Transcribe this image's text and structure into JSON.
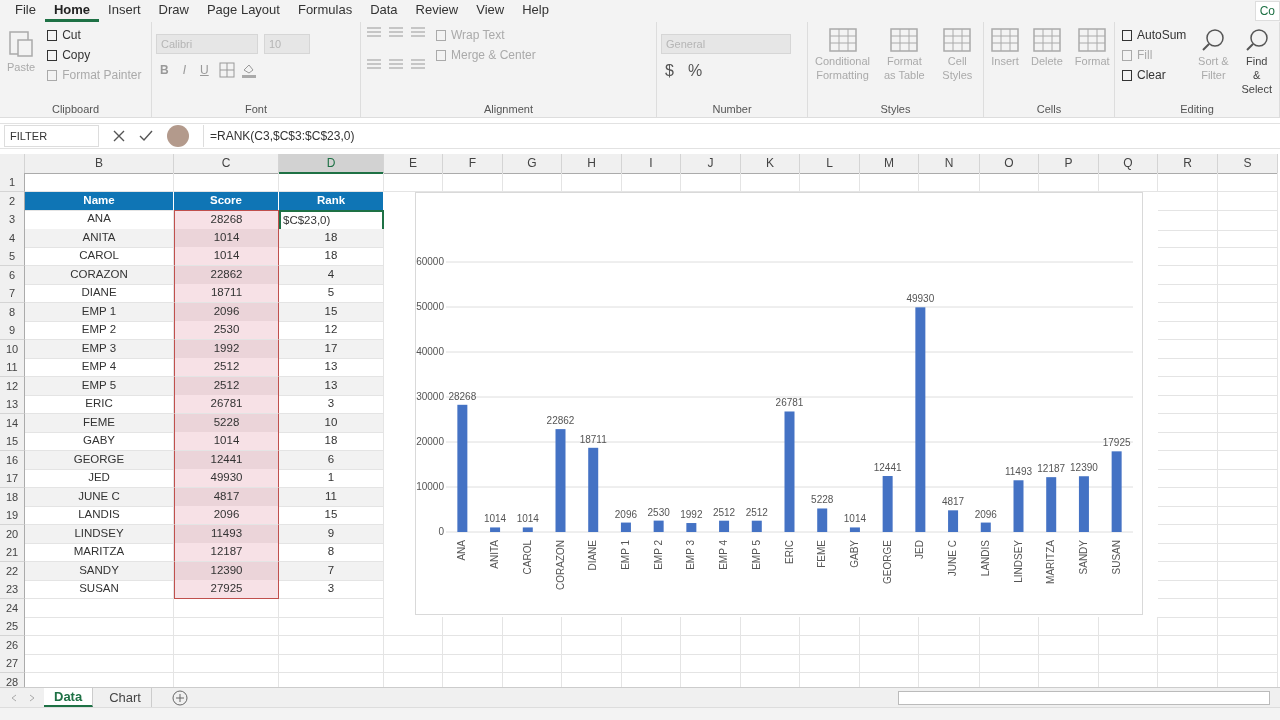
{
  "ribbon_tabs": [
    {
      "label": "File",
      "selected": false
    },
    {
      "label": "Home",
      "selected": true
    },
    {
      "label": "Insert",
      "selected": false
    },
    {
      "label": "Draw",
      "selected": false
    },
    {
      "label": "Page Layout",
      "selected": false
    },
    {
      "label": "Formulas",
      "selected": false
    },
    {
      "label": "Data",
      "selected": false
    },
    {
      "label": "Review",
      "selected": false
    },
    {
      "label": "View",
      "selected": false
    },
    {
      "label": "Help",
      "selected": false
    }
  ],
  "comments_button": "Co",
  "ribbon_groups": [
    {
      "label": "Clipboard",
      "kind": "clipboard",
      "buttons": [
        {
          "label": "Paste",
          "disabled": true
        },
        {
          "label": "Cut",
          "disabled": false
        },
        {
          "label": "Copy",
          "disabled": false
        },
        {
          "label": "Format Painter",
          "disabled": true
        }
      ]
    },
    {
      "label": "Font",
      "kind": "font",
      "font_name": "Calibri",
      "font_size": "10",
      "format_buttons": [
        "B",
        "I",
        "U"
      ]
    },
    {
      "label": "Alignment",
      "kind": "alignment",
      "buttons": [
        {
          "label": "Wrap Text",
          "disabled": true
        },
        {
          "label": "Merge & Center",
          "disabled": true
        }
      ]
    },
    {
      "label": "Number",
      "kind": "number",
      "format": "General",
      "format_buttons": [
        "$",
        "%"
      ]
    },
    {
      "label": "Styles",
      "kind": "large",
      "buttons": [
        {
          "label": "Conditional Formatting",
          "disabled": true
        },
        {
          "label": "Format as Table",
          "disabled": true
        },
        {
          "label": "Cell Styles",
          "disabled": true
        }
      ]
    },
    {
      "label": "Cells",
      "kind": "large",
      "buttons": [
        {
          "label": "Insert",
          "disabled": true
        },
        {
          "label": "Delete",
          "disabled": true
        },
        {
          "label": "Format",
          "disabled": true
        }
      ]
    },
    {
      "label": "Editing",
      "kind": "editing",
      "buttons": [
        {
          "label": "AutoSum",
          "disabled": false
        },
        {
          "label": "Fill",
          "disabled": true
        },
        {
          "label": "Clear",
          "disabled": false
        }
      ],
      "large_buttons": [
        {
          "label": "Sort & Filter",
          "disabled": true
        },
        {
          "label": "Find &",
          "label2": "Select",
          "disabled": false
        }
      ]
    }
  ],
  "formula_bar": {
    "name_box": "FILTER",
    "formula": "=RANK(C3,$C$3:$C$23,0)"
  },
  "sheet": {
    "columns": [
      {
        "label": "B",
        "selected": false
      },
      {
        "label": "C",
        "selected": false
      },
      {
        "label": "D",
        "selected": true
      },
      {
        "label": "E",
        "selected": false
      },
      {
        "label": "F",
        "selected": false
      },
      {
        "label": "G",
        "selected": false
      },
      {
        "label": "H",
        "selected": false
      },
      {
        "label": "I",
        "selected": false
      },
      {
        "label": "J",
        "selected": false
      },
      {
        "label": "K",
        "selected": false
      },
      {
        "label": "L",
        "selected": false
      },
      {
        "label": "M",
        "selected": false
      },
      {
        "label": "N",
        "selected": false
      },
      {
        "label": "O",
        "selected": false
      },
      {
        "label": "P",
        "selected": false
      },
      {
        "label": "Q",
        "selected": false
      },
      {
        "label": "R",
        "selected": false
      },
      {
        "label": "S",
        "selected": false
      }
    ],
    "row_numbers": [
      "1",
      "2",
      "3",
      "4",
      "5",
      "6",
      "7",
      "8",
      "9",
      "10",
      "11",
      "12",
      "13",
      "14",
      "15",
      "16",
      "17",
      "18",
      "19",
      "20",
      "21",
      "22",
      "23",
      "24",
      "25",
      "26",
      "27",
      "28"
    ]
  },
  "table": {
    "headers": [
      "Name",
      "Score",
      "Rank"
    ],
    "score_selected": true,
    "rows": [
      {
        "name": "ANA",
        "score": "28268",
        "rank": "$C$23,0)",
        "editing": true
      },
      {
        "name": "ANITA",
        "score": "1014",
        "rank": "18",
        "editing": false
      },
      {
        "name": "CAROL",
        "score": "1014",
        "rank": "18",
        "editing": false
      },
      {
        "name": "CORAZON",
        "score": "22862",
        "rank": "4",
        "editing": false
      },
      {
        "name": "DIANE",
        "score": "18711",
        "rank": "5",
        "editing": false
      },
      {
        "name": "EMP 1",
        "score": "2096",
        "rank": "15",
        "editing": false
      },
      {
        "name": "EMP 2",
        "score": "2530",
        "rank": "12",
        "editing": false
      },
      {
        "name": "EMP 3",
        "score": "1992",
        "rank": "17",
        "editing": false
      },
      {
        "name": "EMP 4",
        "score": "2512",
        "rank": "13",
        "editing": false
      },
      {
        "name": "EMP 5",
        "score": "2512",
        "rank": "13",
        "editing": false
      },
      {
        "name": "ERIC",
        "score": "26781",
        "rank": "3",
        "editing": false
      },
      {
        "name": "FEME",
        "score": "5228",
        "rank": "10",
        "editing": false
      },
      {
        "name": "GABY",
        "score": "1014",
        "rank": "18",
        "editing": false
      },
      {
        "name": "GEORGE",
        "score": "12441",
        "rank": "6",
        "editing": false
      },
      {
        "name": "JED",
        "score": "49930",
        "rank": "1",
        "editing": false
      },
      {
        "name": "JUNE C",
        "score": "4817",
        "rank": "11",
        "editing": false
      },
      {
        "name": "LANDIS",
        "score": "2096",
        "rank": "15",
        "editing": false
      },
      {
        "name": "LINDSEY",
        "score": "11493",
        "rank": "9",
        "editing": false
      },
      {
        "name": "MARITZA",
        "score": "12187",
        "rank": "8",
        "editing": false
      },
      {
        "name": "SANDY",
        "score": "12390",
        "rank": "7",
        "editing": false
      },
      {
        "name": "SUSAN",
        "score": "27925",
        "rank": "3",
        "editing": false
      }
    ]
  },
  "chart": {
    "chart_data": {
      "type": "bar",
      "categories": [
        "ANA",
        "ANITA",
        "CAROL",
        "CORAZON",
        "DIANE",
        "EMP 1",
        "EMP 2",
        "EMP 3",
        "EMP 4",
        "EMP 5",
        "ERIC",
        "FEME",
        "GABY",
        "GEORGE",
        "JED",
        "JUNE C",
        "LANDIS",
        "LINDSEY",
        "MARITZA",
        "SANDY",
        "SUSAN"
      ],
      "series": [
        {
          "color": "#4472c4",
          "values": [
            28268,
            1014,
            1014,
            22862,
            18711,
            2096,
            2530,
            1992,
            2512,
            2512,
            26781,
            5228,
            1014,
            12441,
            49930,
            4817,
            2096,
            11493,
            12187,
            12390,
            17925
          ]
        }
      ],
      "grid": true,
      "ylim": [
        0,
        60000
      ],
      "yticks": [
        0,
        10000,
        20000,
        30000,
        40000,
        50000,
        60000
      ],
      "data_labels": true
    }
  },
  "sheet_tabs": [
    {
      "label": "Data",
      "selected": true
    },
    {
      "label": "Chart",
      "selected": false
    }
  ]
}
